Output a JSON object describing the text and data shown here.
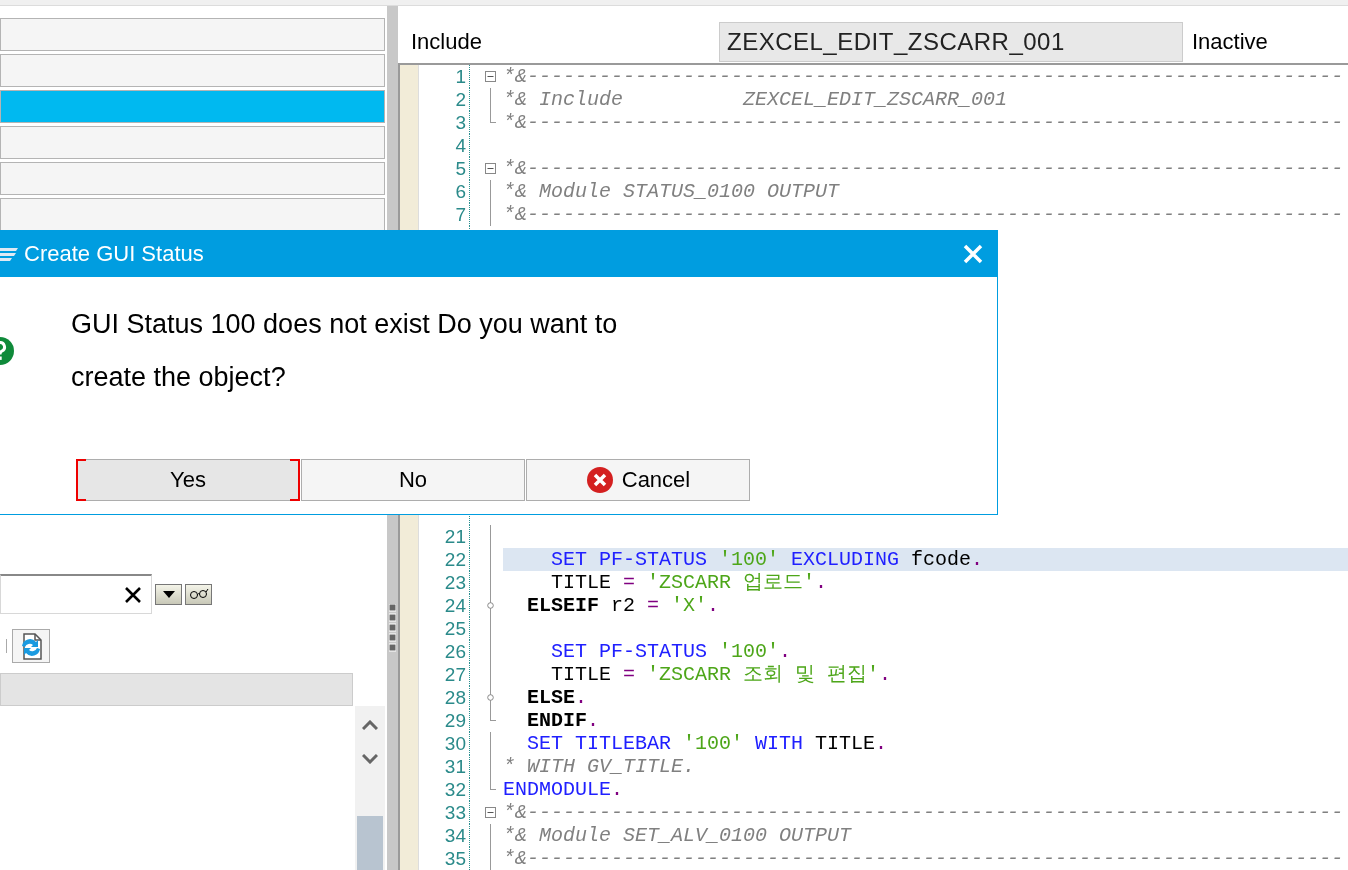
{
  "left_panel": {
    "nav_bars": [
      {
        "selected": false
      },
      {
        "selected": false
      },
      {
        "selected": true
      },
      {
        "selected": false
      },
      {
        "selected": false
      },
      {
        "selected": false
      }
    ]
  },
  "header": {
    "label": "Include",
    "program": "ZEXCEL_EDIT_ZSCARR_001",
    "status": "Inactive"
  },
  "editor": {
    "lines": [
      {
        "number": "1",
        "kind": "fold_start",
        "current": false,
        "tokens": [
          {
            "kind": "comment",
            "text": "*&--------------------------------------------------------------------"
          }
        ]
      },
      {
        "number": "2",
        "kind": "fold_body",
        "current": false,
        "tokens": [
          {
            "kind": "comment",
            "text": "*& Include          ZEXCEL_EDIT_ZSCARR_001"
          }
        ]
      },
      {
        "number": "3",
        "kind": "fold_end",
        "current": false,
        "tokens": [
          {
            "kind": "comment",
            "text": "*&--------------------------------------------------------------------"
          }
        ]
      },
      {
        "number": "4",
        "kind": "plain",
        "current": false
      },
      {
        "number": "5",
        "kind": "fold_start",
        "current": false,
        "tokens": [
          {
            "kind": "comment",
            "text": "*&--------------------------------------------------------------------"
          }
        ]
      },
      {
        "number": "6",
        "kind": "fold_body",
        "current": false,
        "tokens": [
          {
            "kind": "comment",
            "text": "*& Module STATUS_0100 OUTPUT"
          }
        ]
      },
      {
        "number": "7",
        "kind": "fold_body",
        "current": false,
        "tokens": [
          {
            "kind": "comment",
            "text": "*&--------------------------------------------------------------------"
          }
        ]
      },
      {
        "number": "21",
        "kind": "fold_body",
        "current": false
      },
      {
        "number": "22",
        "kind": "fold_body",
        "current": true,
        "tokens": [
          {
            "kind": "keyword",
            "text": "    SET PF-STATUS"
          },
          {
            "kind": "string",
            "text": " '100'"
          },
          {
            "kind": "keyword",
            "text": " EXCLUDING"
          },
          {
            "kind": "text",
            "text": " fcode"
          },
          {
            "kind": "op",
            "text": "."
          }
        ]
      },
      {
        "number": "23",
        "kind": "fold_body",
        "current": false,
        "tokens": [
          {
            "kind": "text",
            "text": "    TITLE"
          },
          {
            "kind": "op",
            "text": " ="
          },
          {
            "kind": "string",
            "text": " 'ZSCARR 업로드'"
          },
          {
            "kind": "op",
            "text": "."
          }
        ]
      },
      {
        "number": "24",
        "kind": "fold_branch",
        "current": false,
        "tokens": [
          {
            "kind": "control",
            "text": "  ELSEIF"
          },
          {
            "kind": "text",
            "text": " r2"
          },
          {
            "kind": "op",
            "text": " ="
          },
          {
            "kind": "string",
            "text": " 'X'"
          },
          {
            "kind": "op",
            "text": "."
          }
        ]
      },
      {
        "number": "25",
        "kind": "fold_body",
        "current": false
      },
      {
        "number": "26",
        "kind": "fold_body",
        "current": false,
        "tokens": [
          {
            "kind": "keyword",
            "text": "    SET PF-STATUS"
          },
          {
            "kind": "string",
            "text": " '100'"
          },
          {
            "kind": "op",
            "text": "."
          }
        ]
      },
      {
        "number": "27",
        "kind": "fold_body",
        "current": false,
        "tokens": [
          {
            "kind": "text",
            "text": "    TITLE"
          },
          {
            "kind": "op",
            "text": " ="
          },
          {
            "kind": "string",
            "text": " 'ZSCARR 조회 및 편집'"
          },
          {
            "kind": "op",
            "text": "."
          }
        ]
      },
      {
        "number": "28",
        "kind": "fold_branch",
        "current": false,
        "tokens": [
          {
            "kind": "control",
            "text": "  ELSE"
          },
          {
            "kind": "op",
            "text": "."
          }
        ]
      },
      {
        "number": "29",
        "kind": "fold_end",
        "current": false,
        "tokens": [
          {
            "kind": "control",
            "text": "  ENDIF"
          },
          {
            "kind": "op",
            "text": "."
          }
        ]
      },
      {
        "number": "30",
        "kind": "fold_body",
        "current": false,
        "tokens": [
          {
            "kind": "keyword",
            "text": "  SET TITLEBAR"
          },
          {
            "kind": "string",
            "text": " '100'"
          },
          {
            "kind": "keyword",
            "text": " WITH"
          },
          {
            "kind": "text",
            "text": " TITLE"
          },
          {
            "kind": "op",
            "text": "."
          }
        ]
      },
      {
        "number": "31",
        "kind": "fold_body",
        "current": false,
        "tokens": [
          {
            "kind": "comment",
            "text": "* WITH GV_TITLE."
          }
        ]
      },
      {
        "number": "32",
        "kind": "fold_end",
        "current": false,
        "tokens": [
          {
            "kind": "keyword",
            "text": "ENDMODULE"
          },
          {
            "kind": "op",
            "text": "."
          }
        ]
      },
      {
        "number": "33",
        "kind": "fold_start",
        "current": false,
        "tokens": [
          {
            "kind": "comment",
            "text": "*&--------------------------------------------------------------------"
          }
        ]
      },
      {
        "number": "34",
        "kind": "fold_body",
        "current": false,
        "tokens": [
          {
            "kind": "comment",
            "text": "*& Module SET_ALV_0100 OUTPUT"
          }
        ]
      },
      {
        "number": "35",
        "kind": "fold_body",
        "current": false,
        "tokens": [
          {
            "kind": "comment",
            "text": "*&--------------------------------------------------------------------"
          }
        ]
      }
    ]
  },
  "dialog": {
    "title": "Create GUI Status",
    "message": "GUI Status 100 does not exist Do you want to create the object?",
    "buttons": [
      {
        "label": "Yes",
        "kind": "plain",
        "focused": true
      },
      {
        "label": "No",
        "kind": "plain",
        "focused": false
      },
      {
        "label": "Cancel",
        "kind": "cancel",
        "focused": false
      }
    ]
  }
}
